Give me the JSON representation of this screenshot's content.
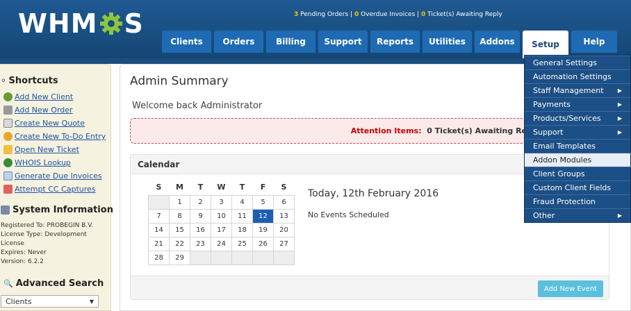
{
  "header": {
    "logo_text_1": "WHM",
    "logo_text_2": "S",
    "notices": {
      "pending_count": "3",
      "pending_label": " Pending Orders | ",
      "overdue_count": "0",
      "overdue_label": " Overdue Invoices | ",
      "ticket_count": "0",
      "ticket_label": " Ticket(s) Awaiting Reply"
    }
  },
  "nav": {
    "tabs": [
      "Clients",
      "Orders",
      "Billing",
      "Support",
      "Reports",
      "Utilities",
      "Addons",
      "Setup",
      "Help"
    ],
    "active": "Setup"
  },
  "sidebar": {
    "shortcuts_title": "Shortcuts",
    "shortcuts": [
      "Add New Client",
      "Add New Order",
      "Create New Quote",
      "Create New To-Do Entry",
      "Open New Ticket",
      "WHOIS Lookup",
      "Generate Due Invoices",
      "Attempt CC Captures"
    ],
    "sysinfo_title": "System Information",
    "sysinfo": {
      "registered": "Registered To: PROBEGIN B.V.",
      "license_type": "License Type: Development",
      "license": "License",
      "expires": "Expires: Never",
      "version": "Version: 6.2.2"
    },
    "search_title": "Advanced Search",
    "search_select": "Clients"
  },
  "main": {
    "title": "Admin Summary",
    "welcome": "Welcome back Administrator",
    "attention_label": "Attention Items:",
    "attention_text": "0 Ticket(s) Awaiting Re",
    "calendar_title": "Calendar",
    "today_text": "Today, 12th February 2016",
    "no_events": "No Events Scheduled",
    "add_event": "Add New Event",
    "weekdays": [
      "S",
      "M",
      "T",
      "W",
      "T",
      "F",
      "S"
    ],
    "weeks": [
      [
        "",
        "1",
        "2",
        "3",
        "4",
        "5",
        "6"
      ],
      [
        "7",
        "8",
        "9",
        "10",
        "11",
        "12",
        "13"
      ],
      [
        "14",
        "15",
        "16",
        "17",
        "18",
        "19",
        "20"
      ],
      [
        "21",
        "22",
        "23",
        "24",
        "25",
        "26",
        "27"
      ],
      [
        "28",
        "29",
        "",
        "",
        "",
        "",
        ""
      ]
    ],
    "today_day": "12"
  },
  "setup_menu": [
    {
      "label": "General Settings",
      "sub": false
    },
    {
      "label": "Automation Settings",
      "sub": false
    },
    {
      "label": "Staff Management",
      "sub": true
    },
    {
      "label": "Payments",
      "sub": true
    },
    {
      "label": "Products/Services",
      "sub": true
    },
    {
      "label": "Support",
      "sub": true
    },
    {
      "label": "Email Templates",
      "sub": false
    },
    {
      "label": "Addon Modules",
      "sub": false,
      "highlight": true
    },
    {
      "label": "Client Groups",
      "sub": false
    },
    {
      "label": "Custom Client Fields",
      "sub": false
    },
    {
      "label": "Fraud Protection",
      "sub": false
    },
    {
      "label": "Other",
      "sub": true
    }
  ],
  "colors": {
    "header": "#1a4d80",
    "tab": "#1e6bb4",
    "sidebar_bg": "#f6f2e0",
    "today": "#1f5db3",
    "button": "#5bc0de",
    "attention": "#c00"
  }
}
